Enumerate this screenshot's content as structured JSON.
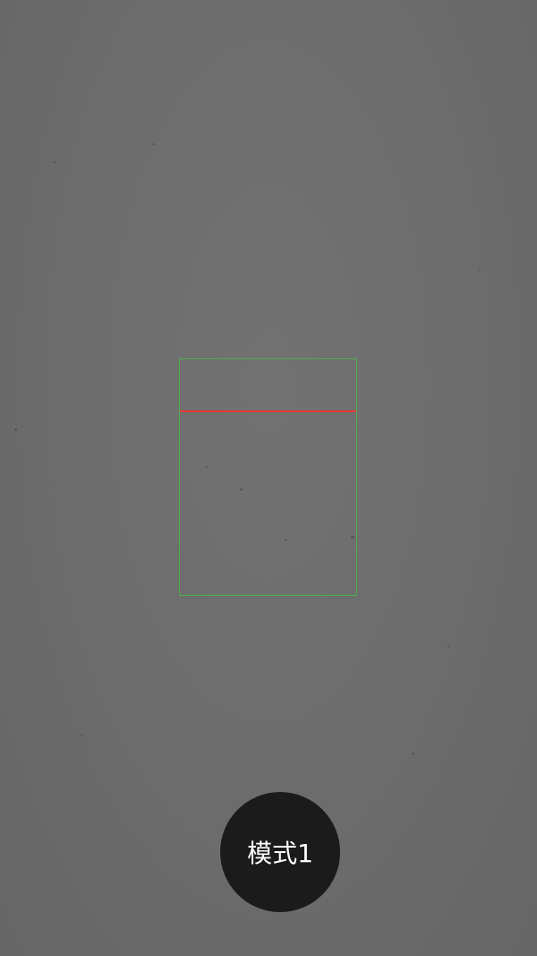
{
  "scanner": {
    "scan_line_color": "#e53935",
    "frame_color": "#4caf50"
  },
  "mode_button": {
    "label": "模式1"
  }
}
